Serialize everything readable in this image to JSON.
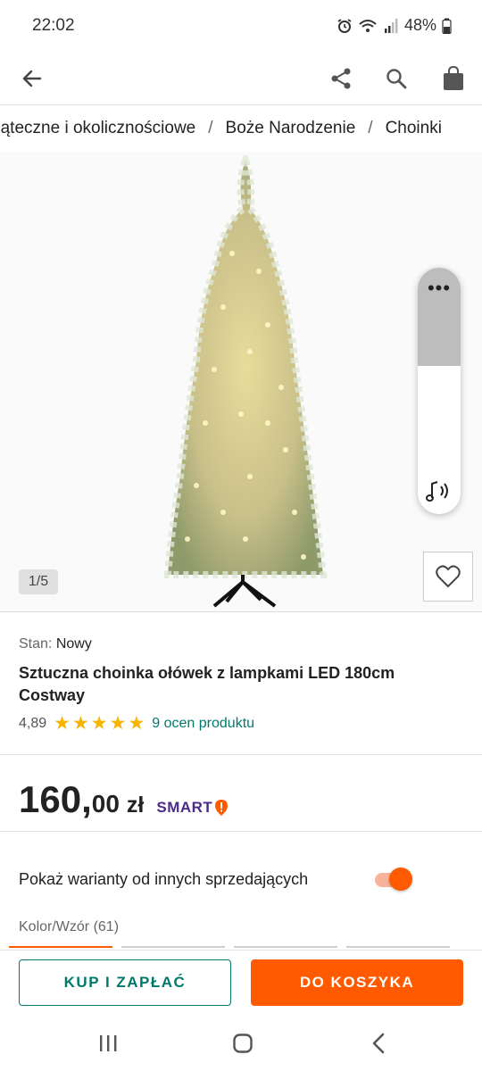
{
  "status": {
    "time": "22:02",
    "battery": "48%"
  },
  "breadcrumb": {
    "items": [
      "Świąteczne i okolicznościowe",
      "Boże Narodzenie",
      "Choinki"
    ],
    "separator": "/"
  },
  "gallery": {
    "counter": "1/5"
  },
  "product": {
    "condition_label": "Stan:",
    "condition_value": "Nowy",
    "title": "Sztuczna choinka ołówek z lampkami LED 180cm Costway",
    "rating": "4,89",
    "stars": 5,
    "rating_link": "9 ocen produktu"
  },
  "price": {
    "integer": "160,",
    "decimal": "00",
    "currency": "zł",
    "smart": "SMART"
  },
  "variants": {
    "toggle_label": "Pokaż warianty od innych sprzedających",
    "toggle_on": true,
    "heading": "Kolor/Wzór (61)"
  },
  "actions": {
    "buy_label": "KUP I ZAPŁAĆ",
    "cart_label": "DO KOSZYKA"
  },
  "colors": {
    "accent": "#ff5a00",
    "teal": "#00796b",
    "star": "#f7b500",
    "smart": "#4b2a8a"
  }
}
